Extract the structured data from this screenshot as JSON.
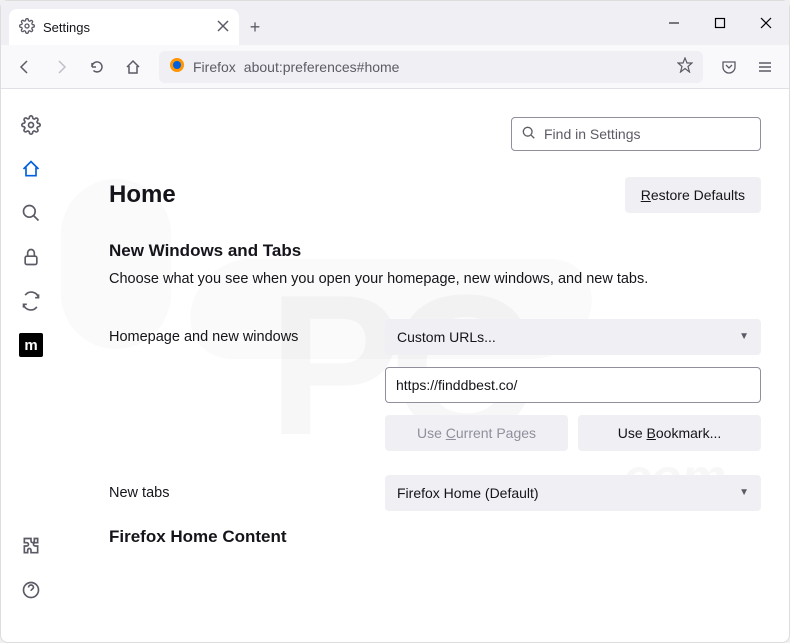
{
  "tab": {
    "title": "Settings"
  },
  "urlbar": {
    "prefix": "Firefox",
    "address": "about:preferences#home"
  },
  "search": {
    "placeholder": "Find in Settings"
  },
  "page": {
    "title": "Home"
  },
  "buttons": {
    "restore_defaults": "Restore Defaults",
    "use_current": "Use Current Pages",
    "use_bookmark": "Use Bookmark..."
  },
  "section": {
    "title": "New Windows and Tabs",
    "desc": "Choose what you see when you open your homepage, new windows, and new tabs.",
    "homepage_label": "Homepage and new windows",
    "newtabs_label": "New tabs",
    "custom_urls": "Custom URLs...",
    "homepage_value": "https://finddbest.co/",
    "newtabs_value": "Firefox Home (Default)",
    "home_content": "Firefox Home Content"
  },
  "sidebar": {
    "moz": "m"
  }
}
